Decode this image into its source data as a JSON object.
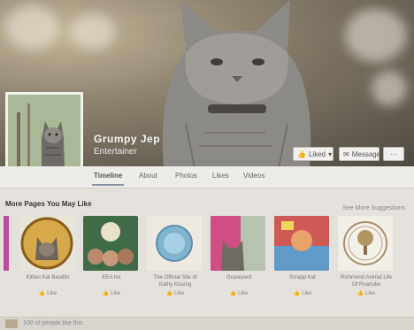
{
  "page": {
    "name": "Grumpy Jep",
    "category": "Entertainer"
  },
  "actions": {
    "liked_label": "Liked",
    "message_label": "Message",
    "more_label": "···"
  },
  "tabs": [
    "Timeline",
    "About",
    "Photos",
    "Likes",
    "Videos"
  ],
  "more_pages": {
    "title": "More Pages You May Like",
    "link": "See More Suggestions",
    "cards": [
      {
        "name": "Kitties Kat Bandits",
        "like": "Like"
      },
      {
        "name": "EEA Inc",
        "like": "Like"
      },
      {
        "name": "The Official Site of Kathy Kissing",
        "like": "Like"
      },
      {
        "name": "Graveyard",
        "like": "Like"
      },
      {
        "name": "Scrapp Kat",
        "like": "Like"
      },
      {
        "name": "Richmond Animal Life Of Roanoke",
        "like": "Like"
      }
    ]
  },
  "footer_strip": {
    "text": "100 of people like this"
  },
  "colors": {
    "tab_underline": "#8a93a6",
    "page_bg": "#e4e1dc"
  }
}
